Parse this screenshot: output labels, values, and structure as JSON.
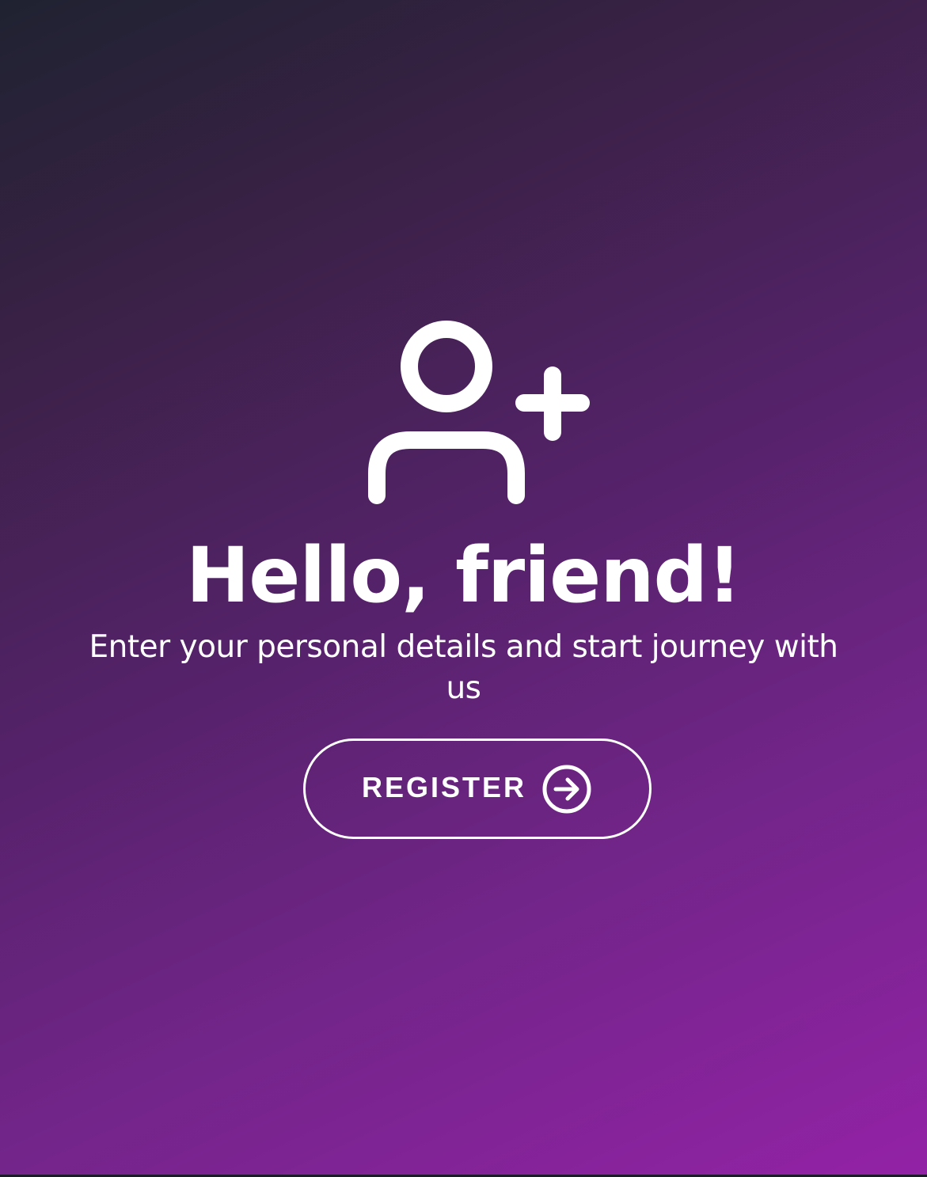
{
  "theme": {
    "gradient_start": "#1f2231",
    "gradient_mid": "#55226a",
    "gradient_end": "#9322a6",
    "text_color": "#ffffff"
  },
  "hero": {
    "icon": "add-user-icon",
    "title": "Hello, friend!",
    "subtitle": "Enter your personal details and start journey with us"
  },
  "register_button": {
    "label": "REGISTER",
    "icon": "arrow-right-circle-icon"
  }
}
